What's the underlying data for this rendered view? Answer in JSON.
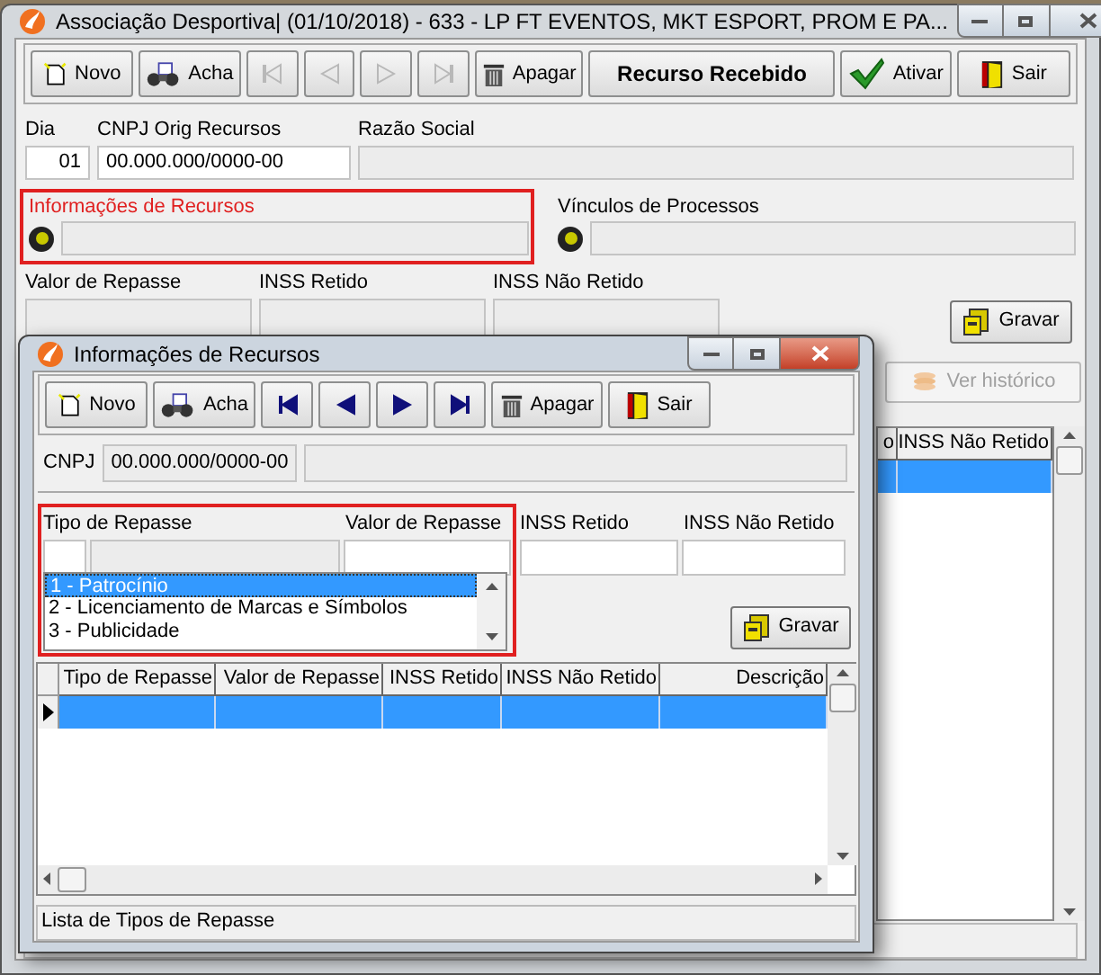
{
  "main_window": {
    "title": "Associação Desportiva| (01/10/2018) - 633 - LP FT EVENTOS, MKT ESPORT, PROM E PA...",
    "toolbar": [
      {
        "kind": "new",
        "label": "Novo",
        "disabled": false
      },
      {
        "kind": "find",
        "label": "Acha",
        "disabled": false
      },
      {
        "kind": "first",
        "disabled": true
      },
      {
        "kind": "prev",
        "disabled": true
      },
      {
        "kind": "next",
        "disabled": true
      },
      {
        "kind": "last",
        "disabled": true
      },
      {
        "kind": "delete",
        "label": "Apagar",
        "disabled": false
      },
      {
        "kind": "text",
        "label": "Recurso Recebido",
        "disabled": false
      },
      {
        "kind": "activate",
        "label": "Ativar",
        "disabled": false
      },
      {
        "kind": "exit",
        "label": "Sair",
        "disabled": false
      }
    ],
    "dia": {
      "label": "Dia",
      "value": "01"
    },
    "cnpj": {
      "label": "CNPJ Orig Recursos",
      "value": "00.000.000/0000-00"
    },
    "razao_social": {
      "label": "Razão Social"
    },
    "sections": [
      {
        "label": "Informações de Recursos",
        "on": true,
        "highlighted": true
      },
      {
        "label": "Vínculos de Processos",
        "on": true,
        "highlighted": false
      }
    ],
    "amount_fields": [
      {
        "label": "Valor de Repasse"
      },
      {
        "label": "INSS Retido"
      },
      {
        "label": "INSS Não Retido"
      }
    ],
    "save_button": {
      "label": "Gravar"
    },
    "history_button": {
      "label": "Ver histórico",
      "disabled": true
    },
    "grid": {
      "columns": [
        "o",
        "INSS Não Retido"
      ],
      "rows": [
        {
          "selected": true
        }
      ]
    }
  },
  "dialog": {
    "title": "Informações de Recursos",
    "toolbar": [
      {
        "kind": "new",
        "label": "Novo",
        "disabled": false
      },
      {
        "kind": "find",
        "label": "Acha",
        "disabled": false
      },
      {
        "kind": "first",
        "disabled": false
      },
      {
        "kind": "prev",
        "disabled": false
      },
      {
        "kind": "next",
        "disabled": false
      },
      {
        "kind": "last",
        "disabled": false
      },
      {
        "kind": "delete",
        "label": "Apagar",
        "disabled": false
      },
      {
        "kind": "exit",
        "label": "Sair",
        "disabled": false
      }
    ],
    "cnpj": {
      "label": "CNPJ",
      "value": "00.000.000/0000-00"
    },
    "tipo_repasse": {
      "label": "Tipo de Repasse",
      "highlighted": true,
      "options": [
        {
          "label": "1 - Patrocínio",
          "selected": true
        },
        {
          "label": "2 - Licenciamento de Marcas e Símbolos",
          "selected": false
        },
        {
          "label": "3 - Publicidade",
          "selected": false
        }
      ]
    },
    "amount_fields": [
      {
        "label": "Valor de Repasse"
      },
      {
        "label": "INSS Retido"
      },
      {
        "label": "INSS Não Retido"
      }
    ],
    "save_button": {
      "label": "Gravar"
    },
    "grid": {
      "columns": [
        "Tipo de Repasse",
        "Valor de Repasse",
        "INSS Retido",
        "INSS Não Retido",
        "Descrição"
      ],
      "rows": [
        {
          "selected": true
        }
      ]
    },
    "status_bar": "Lista de Tipos de Repasse"
  }
}
